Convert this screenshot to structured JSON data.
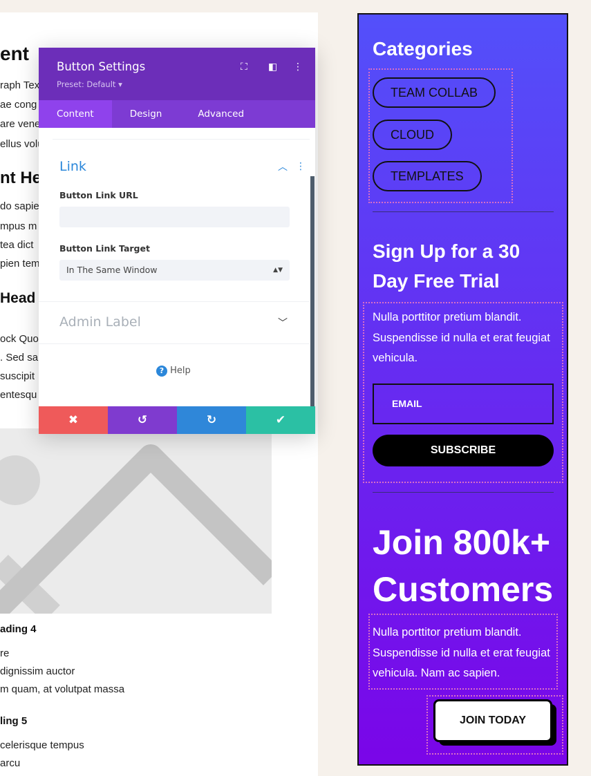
{
  "page": {
    "fragments": [
      "ent",
      "raph Tex",
      "ae cong",
      "are vene",
      "ellus volu",
      "nt He",
      "do sapie",
      "mpus m",
      "tea dict",
      "pien temp",
      "Head",
      "ock Quot",
      ". Sed sa",
      "suscipit",
      "entesqu"
    ],
    "heading4": "ading 4",
    "h4_lines": [
      "re",
      "dignissim auctor",
      "m quam, at volutpat massa"
    ],
    "heading5": "ling 5",
    "h5_lines": [
      "celerisque tempus",
      "arcu"
    ]
  },
  "modal": {
    "title": "Button Settings",
    "preset": "Preset: Default",
    "icons": [
      "expand-icon",
      "sidebar-icon",
      "more-icon"
    ],
    "tabs": [
      "Content",
      "Design",
      "Advanced"
    ],
    "section": "Link",
    "url_label": "Button Link URL",
    "url_value": "",
    "target_label": "Button Link Target",
    "target_value": "In The Same Window",
    "admin_label": "Admin Label",
    "help": "Help",
    "footer_colors": [
      "#ef5a5a",
      "#7f3bcf",
      "#2f87d9",
      "#2bc0a4"
    ]
  },
  "sidebar": {
    "categories_title": "Categories",
    "categories": [
      "TEAM COLLAB",
      "CLOUD",
      "TEMPLATES"
    ],
    "signup_title": "Sign Up for a 30 Day Free Trial",
    "signup_text": "Nulla porttitor pretium blandit. Suspendisse id nulla et erat feugiat vehicula.",
    "email_placeholder": "EMAIL",
    "subscribe": "SUBSCRIBE",
    "join_title": "Join 800k+ Customers",
    "join_text": "Nulla porttitor pretium blandit. Suspendisse id nulla et erat feugiat vehicula. Nam ac sapien.",
    "join_button": "JOIN TODAY",
    "gradient": [
      "#5350fa",
      "#7a05e8"
    ]
  }
}
